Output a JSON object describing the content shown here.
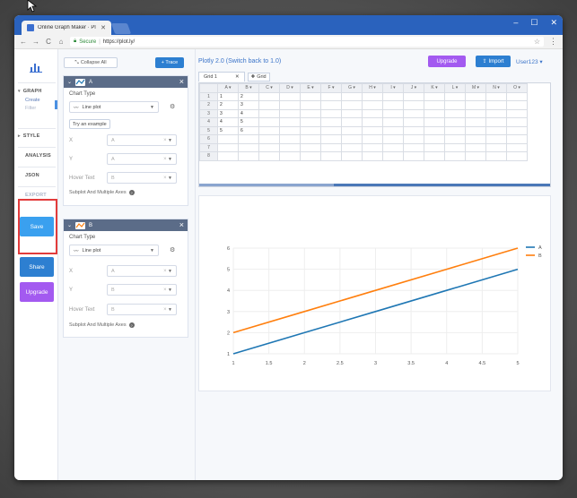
{
  "browser": {
    "tab_title": "Online Graph Maker · Pl",
    "tab_close": "✕",
    "secure_label": "Secure",
    "url": "https://plot.ly/",
    "window_controls": [
      "–",
      "☐",
      "✕"
    ]
  },
  "leftnav": {
    "graph": "GRAPH",
    "create": "Create",
    "filter": "Filter",
    "style": "STYLE",
    "analysis": "ANALYSIS",
    "json": "JSON",
    "export": "EXPORT",
    "save": "Save",
    "share": "Share",
    "upgrade": "Upgrade"
  },
  "panel": {
    "collapse_all": "Collapse All",
    "add_trace": "+ Trace",
    "traces": [
      {
        "name": "A",
        "color": "#1f77b4",
        "chart_type_label": "Chart Type",
        "chart_type": "Line plot",
        "try_example": "Try an example",
        "x_label": "X",
        "x_value": "A",
        "y_label": "Y",
        "y_value": "A",
        "hover_label": "Hover Text",
        "hover_value": "B",
        "subplot": "Subplot And Multiple Axes"
      },
      {
        "name": "B",
        "color": "#ff7f0e",
        "chart_type_label": "Chart Type",
        "chart_type": "Line plot",
        "x_label": "X",
        "x_value": "A",
        "y_label": "Y",
        "y_value": "B",
        "hover_label": "Hover Text",
        "hover_value": "B",
        "subplot": "Subplot And Multiple Axes"
      }
    ]
  },
  "main": {
    "title": "Plotly 2.0 (Switch back to 1.0)",
    "upgrade": "Upgrade",
    "import": "Import",
    "user": "User123 ▾",
    "grid_tab": "Grid 1",
    "grid_tab_close": "✕",
    "add_grid": "Grid",
    "columns": [
      "A",
      "B",
      "C",
      "D",
      "E",
      "F",
      "G",
      "H",
      "I",
      "J",
      "K",
      "L",
      "M",
      "N",
      "O"
    ],
    "rows": [
      [
        "1",
        "1",
        "2"
      ],
      [
        "2",
        "2",
        "3"
      ],
      [
        "3",
        "3",
        "4"
      ],
      [
        "4",
        "4",
        "5"
      ],
      [
        "5",
        "5",
        "6"
      ],
      [
        "6",
        "",
        ""
      ],
      [
        "7",
        "",
        ""
      ],
      [
        "8",
        "",
        ""
      ]
    ]
  },
  "chart_data": {
    "type": "line",
    "x": [
      1,
      2,
      3,
      4,
      5
    ],
    "series": [
      {
        "name": "A",
        "values": [
          1,
          2,
          3,
          4,
          5
        ],
        "color": "#1f77b4"
      },
      {
        "name": "B",
        "values": [
          2,
          3,
          4,
          5,
          6
        ],
        "color": "#ff7f0e"
      }
    ],
    "xticks": [
      "1",
      "1.5",
      "2",
      "2.5",
      "3",
      "3.5",
      "4",
      "4.5",
      "5"
    ],
    "yticks": [
      "1",
      "2",
      "3",
      "4",
      "5",
      "6"
    ],
    "xlim": [
      1,
      5
    ],
    "ylim": [
      1,
      6
    ],
    "grid": true,
    "legend": "top-right"
  }
}
